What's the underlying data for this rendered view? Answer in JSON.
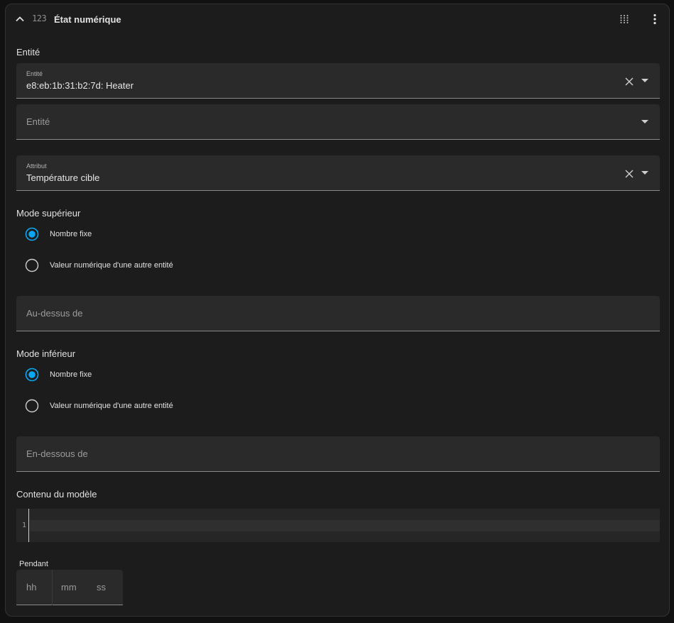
{
  "header": {
    "title": "État numérique",
    "type_icon_text": "123",
    "icons": [
      "chevron-up-icon",
      "numeric-icon",
      "drag-handle-icon",
      "more-vertical-icon"
    ]
  },
  "entity_section": {
    "label": "Entité",
    "entity_field": {
      "label": "Entité",
      "value": "e8:eb:1b:31:b2:7d: Heater"
    },
    "entity_field_2": {
      "placeholder": "Entité"
    },
    "attribute_field": {
      "label": "Attribut",
      "value": "Température cible"
    }
  },
  "upper_mode": {
    "label": "Mode supérieur",
    "options": [
      "Nombre fixe",
      "Valeur numérique d'une autre entité"
    ],
    "selected": 0,
    "input_placeholder": "Au-dessus de"
  },
  "lower_mode": {
    "label": "Mode inférieur",
    "options": [
      "Nombre fixe",
      "Valeur numérique d'une autre entité"
    ],
    "selected": 0,
    "input_placeholder": "En-dessous de"
  },
  "template": {
    "label": "Contenu du modèle",
    "line_number": "1"
  },
  "duration": {
    "label": "Pendant",
    "hh": "hh",
    "mm": "mm",
    "ss": "ss"
  },
  "colors": {
    "accent": "#03a9f4",
    "background": "#111111",
    "card": "#1c1c1c",
    "field": "#2a2a2a"
  }
}
